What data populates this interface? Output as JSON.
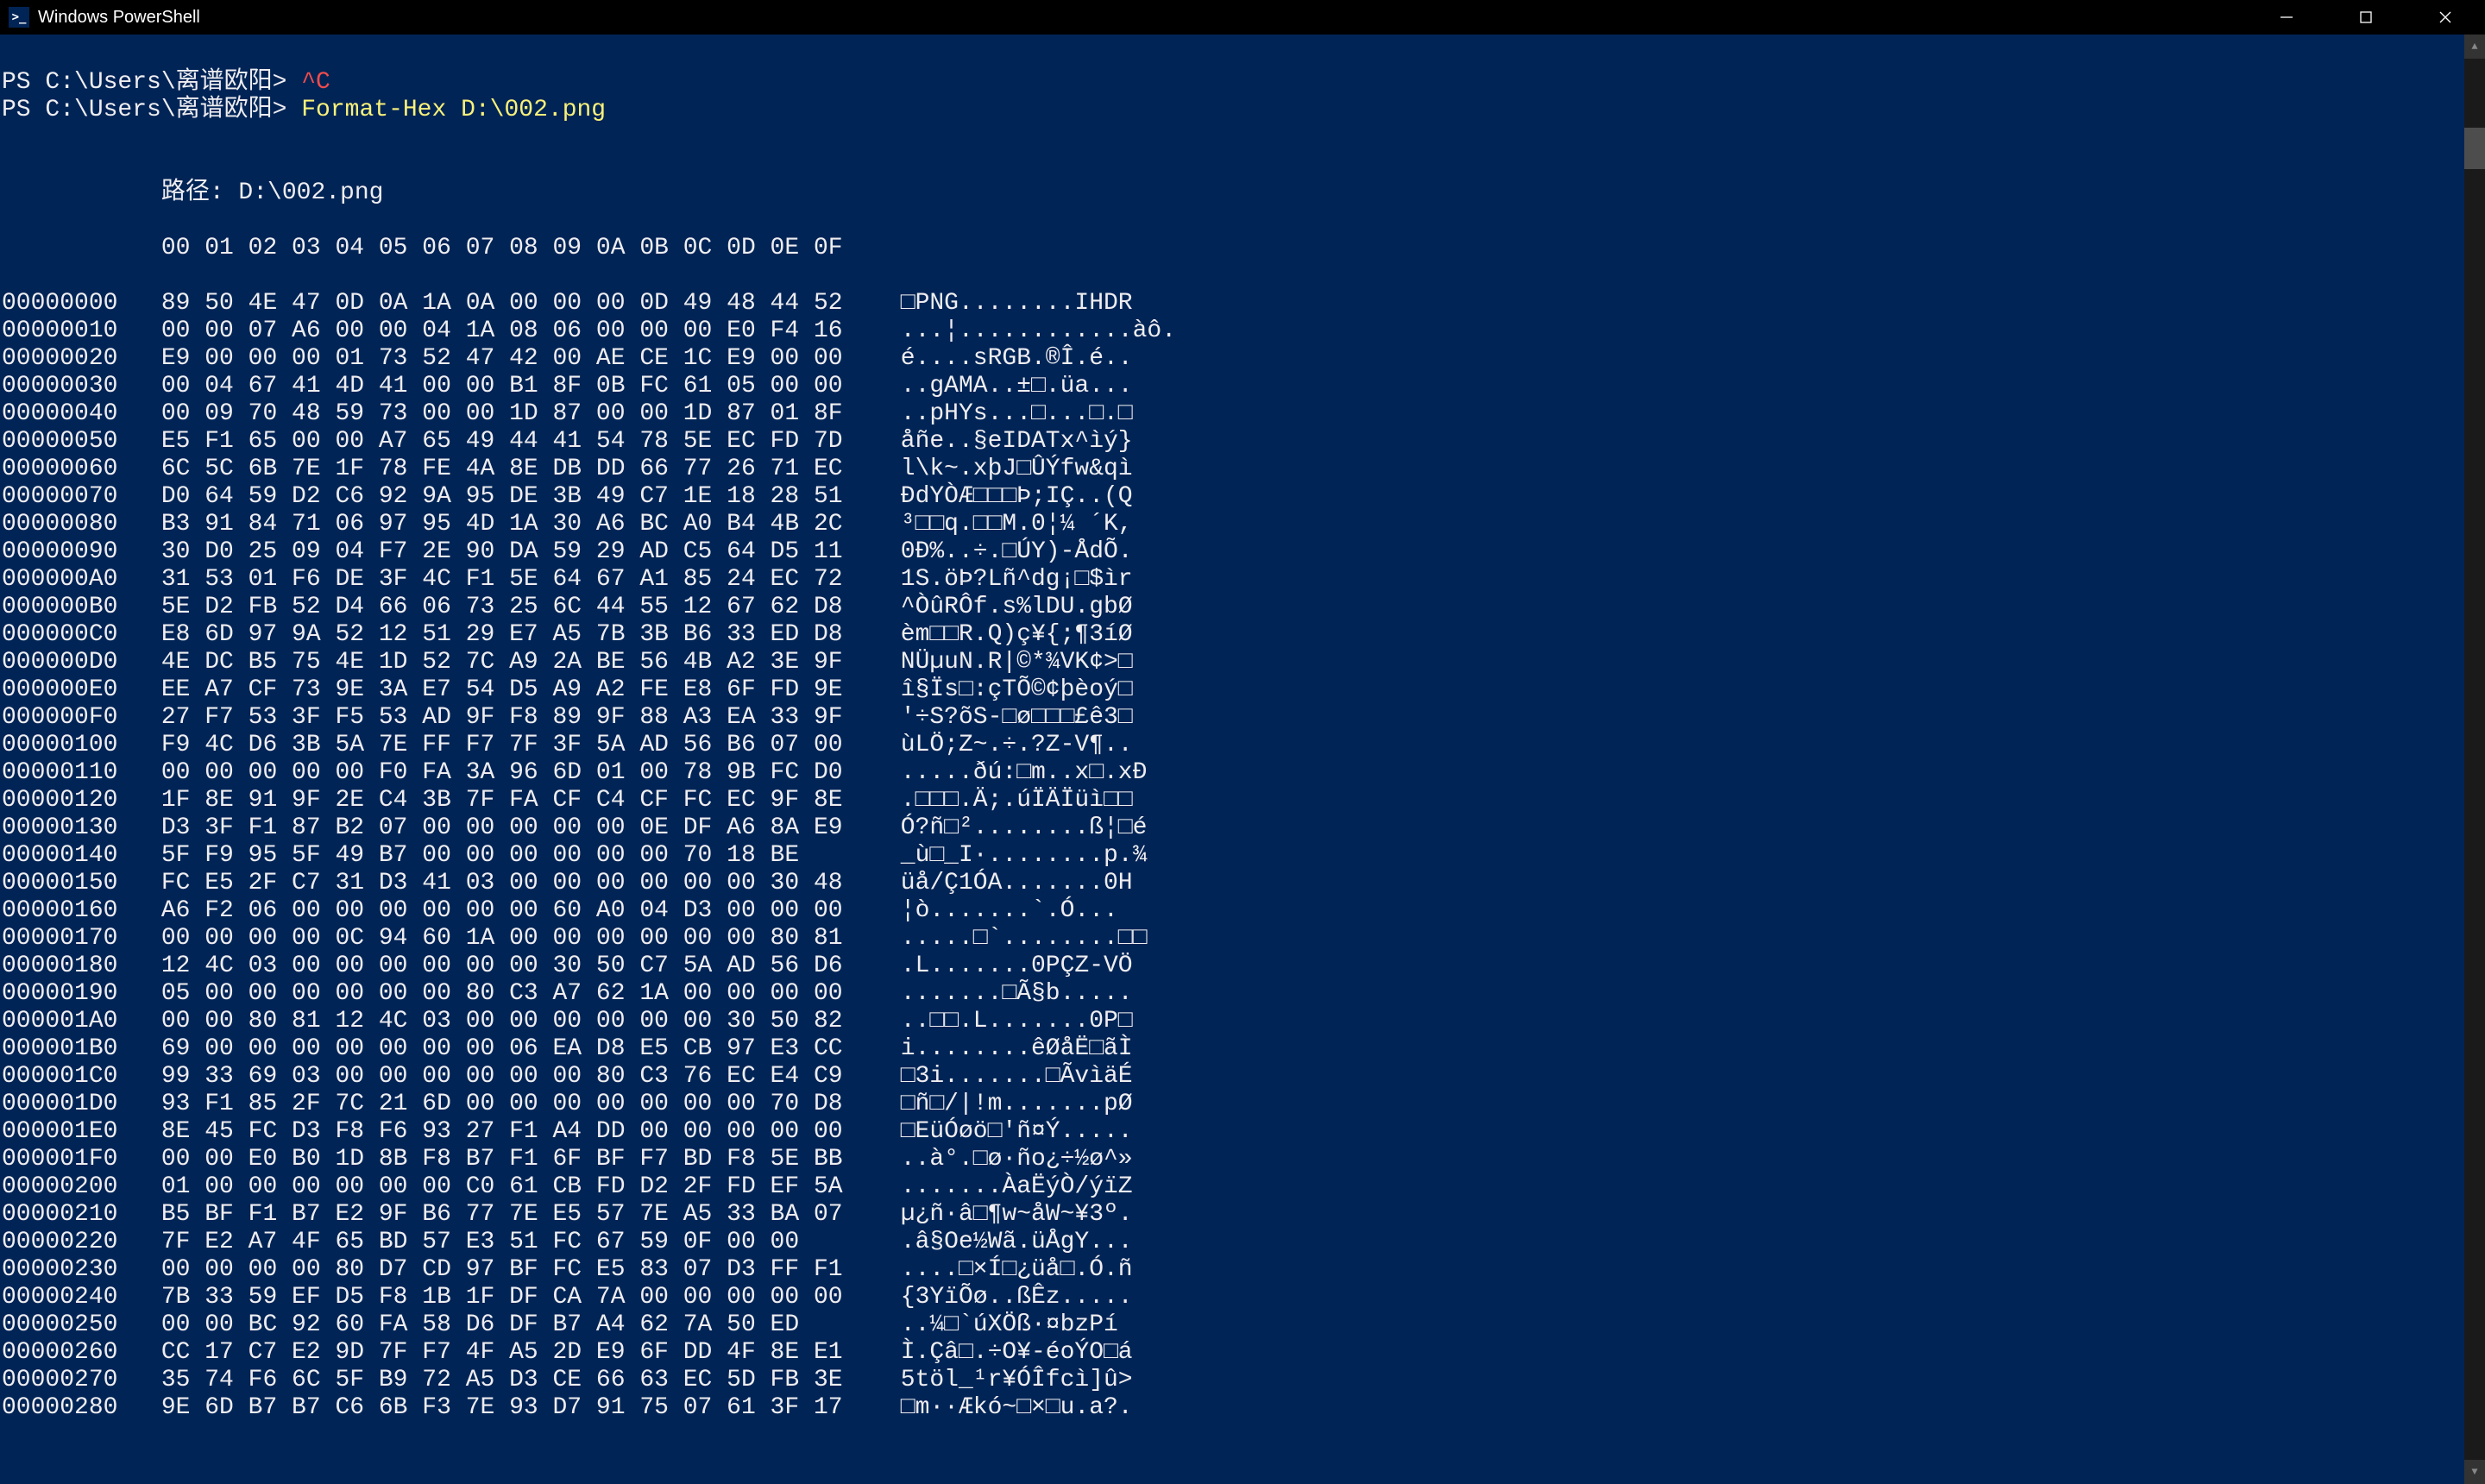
{
  "window": {
    "title": "Windows PowerShell"
  },
  "winbuttons": {
    "min": "minimize",
    "max": "maximize",
    "close": "close"
  },
  "prompt1_prefix": "PS C:\\Users\\离谱欧阳> ",
  "prompt1_cmd": "^C",
  "prompt2_prefix": "PS C:\\Users\\离谱欧阳> ",
  "prompt2_cmd": "Format-Hex D:\\002.png",
  "path_label": "           路径: D:\\002.png",
  "header": "           00 01 02 03 04 05 06 07 08 09 0A 0B 0C 0D 0E 0F",
  "rows": [
    {
      "off": "00000000",
      "hex": "89 50 4E 47 0D 0A 1A 0A 00 00 00 0D 49 48 44 52",
      "asc": "□PNG........IHDR"
    },
    {
      "off": "00000010",
      "hex": "00 00 07 A6 00 00 04 1A 08 06 00 00 00 E0 F4 16",
      "asc": "...¦............àô."
    },
    {
      "off": "00000020",
      "hex": "E9 00 00 00 01 73 52 47 42 00 AE CE 1C E9 00 00",
      "asc": "é....sRGB.®Î.é.."
    },
    {
      "off": "00000030",
      "hex": "00 04 67 41 4D 41 00 00 B1 8F 0B FC 61 05 00 00",
      "asc": "..gAMA..±□.üa..."
    },
    {
      "off": "00000040",
      "hex": "00 09 70 48 59 73 00 00 1D 87 00 00 1D 87 01 8F",
      "asc": "..pHYs...□...□.□"
    },
    {
      "off": "00000050",
      "hex": "E5 F1 65 00 00 A7 65 49 44 41 54 78 5E EC FD 7D",
      "asc": "åñe..§eIDATx^ìý}"
    },
    {
      "off": "00000060",
      "hex": "6C 5C 6B 7E 1F 78 FE 4A 8E DB DD 66 77 26 71 EC",
      "asc": "l\\k~.xþJ□ÛÝfw&qì"
    },
    {
      "off": "00000070",
      "hex": "D0 64 59 D2 C6 92 9A 95 DE 3B 49 C7 1E 18 28 51",
      "asc": "ÐdYÒÆ□□□Þ;IÇ..(Q"
    },
    {
      "off": "00000080",
      "hex": "B3 91 84 71 06 97 95 4D 1A 30 A6 BC A0 B4 4B 2C",
      "asc": "³□□q.□□M.0¦¼ ´K,"
    },
    {
      "off": "00000090",
      "hex": "30 D0 25 09 04 F7 2E 90 DA 59 29 AD C5 64 D5 11",
      "asc": "0Ð%..÷.□ÚY)-ÅdÕ."
    },
    {
      "off": "000000A0",
      "hex": "31 53 01 F6 DE 3F 4C F1 5E 64 67 A1 85 24 EC 72",
      "asc": "1S.öÞ?Lñ^dg¡□$ìr"
    },
    {
      "off": "000000B0",
      "hex": "5E D2 FB 52 D4 66 06 73 25 6C 44 55 12 67 62 D8",
      "asc": "^ÒûRÔf.s%lDU.gbØ"
    },
    {
      "off": "000000C0",
      "hex": "E8 6D 97 9A 52 12 51 29 E7 A5 7B 3B B6 33 ED D8",
      "asc": "èm□□R.Q)ç¥{;¶3íØ"
    },
    {
      "off": "000000D0",
      "hex": "4E DC B5 75 4E 1D 52 7C A9 2A BE 56 4B A2 3E 9F",
      "asc": "NÜµuN.R|©*¾VK¢>□"
    },
    {
      "off": "000000E0",
      "hex": "EE A7 CF 73 9E 3A E7 54 D5 A9 A2 FE E8 6F FD 9E",
      "asc": "î§Ïs□:çTÕ©¢þèoý□"
    },
    {
      "off": "000000F0",
      "hex": "27 F7 53 3F F5 53 AD 9F F8 89 9F 88 A3 EA 33 9F",
      "asc": "'÷S?õS-□ø□□□£ê3□"
    },
    {
      "off": "00000100",
      "hex": "F9 4C D6 3B 5A 7E FF F7 7F 3F 5A AD 56 B6 07 00",
      "asc": "ùLÖ;Z~.÷.?Z-V¶.."
    },
    {
      "off": "00000110",
      "hex": "00 00 00 00 00 F0 FA 3A 96 6D 01 00 78 9B FC D0",
      "asc": ".....ðú:□m..x□.xÐ"
    },
    {
      "off": "00000120",
      "hex": "1F 8E 91 9F 2E C4 3B 7F FA CF C4 CF FC EC 9F 8E",
      "asc": ".□□□.Ä;.úÏÄÏüì□□"
    },
    {
      "off": "00000130",
      "hex": "D3 3F F1 87 B2 07 00 00 00 00 00 0E DF A6 8A E9",
      "asc": "Ó?ñ□²........ß¦□é"
    },
    {
      "off": "00000140",
      "hex": "5F F9 95 5F 49 B7 00 00 00 00 00 00 70 18 BE",
      "asc": "_ù□_I·........p.¾"
    },
    {
      "off": "00000150",
      "hex": "FC E5 2F C7 31 D3 41 03 00 00 00 00 00 00 30 48",
      "asc": "üå/Ç1ÓA.......0H"
    },
    {
      "off": "00000160",
      "hex": "A6 F2 06 00 00 00 00 00 00 60 A0 04 D3 00 00 00",
      "asc": "¦ò.......`.Ó..."
    },
    {
      "off": "00000170",
      "hex": "00 00 00 00 0C 94 60 1A 00 00 00 00 00 00 80 81",
      "asc": ".....□`........□□"
    },
    {
      "off": "00000180",
      "hex": "12 4C 03 00 00 00 00 00 00 30 50 C7 5A AD 56 D6",
      "asc": ".L.......0PÇZ-VÖ"
    },
    {
      "off": "00000190",
      "hex": "05 00 00 00 00 00 00 80 C3 A7 62 1A 00 00 00 00",
      "asc": ".......□Ã§b....."
    },
    {
      "off": "000001A0",
      "hex": "00 00 80 81 12 4C 03 00 00 00 00 00 00 30 50 82",
      "asc": "..□□.L.......0P□"
    },
    {
      "off": "000001B0",
      "hex": "69 00 00 00 00 00 00 00 06 EA D8 E5 CB 97 E3 CC",
      "asc": "i........êØåË□ãÌ"
    },
    {
      "off": "000001C0",
      "hex": "99 33 69 03 00 00 00 00 00 00 80 C3 76 EC E4 C9",
      "asc": "□3i.......□ÃvìäÉ"
    },
    {
      "off": "000001D0",
      "hex": "93 F1 85 2F 7C 21 6D 00 00 00 00 00 00 00 70 D8",
      "asc": "□ñ□/|!m.......pØ"
    },
    {
      "off": "000001E0",
      "hex": "8E 45 FC D3 F8 F6 93 27 F1 A4 DD 00 00 00 00 00",
      "asc": "□EüÓøö□'ñ¤Ý....."
    },
    {
      "off": "000001F0",
      "hex": "00 00 E0 B0 1D 8B F8 B7 F1 6F BF F7 BD F8 5E BB",
      "asc": "..à°.□ø·ño¿÷½ø^»"
    },
    {
      "off": "00000200",
      "hex": "01 00 00 00 00 00 00 C0 61 CB FD D2 2F FD EF 5A",
      "asc": ".......ÀaËýÒ/ýïZ"
    },
    {
      "off": "00000210",
      "hex": "B5 BF F1 B7 E2 9F B6 77 7E E5 57 7E A5 33 BA 07",
      "asc": "µ¿ñ·â□¶w~åW~¥3º."
    },
    {
      "off": "00000220",
      "hex": "7F E2 A7 4F 65 BD 57 E3 51 FC 67 59 0F 00 00",
      "asc": ".â§Oe½Wã.üÅgY..."
    },
    {
      "off": "00000230",
      "hex": "00 00 00 00 80 D7 CD 97 BF FC E5 83 07 D3 FF F1",
      "asc": "....□×Í□¿üå□.Ó.ñ"
    },
    {
      "off": "00000240",
      "hex": "7B 33 59 EF D5 F8 1B 1F DF CA 7A 00 00 00 00 00",
      "asc": "{3YïÕø..ßÊz....."
    },
    {
      "off": "00000250",
      "hex": "00 00 BC 92 60 FA 58 D6 DF B7 A4 62 7A 50 ED",
      "asc": "..¼□`úXÖß·¤bzPí"
    },
    {
      "off": "00000260",
      "hex": "CC 17 C7 E2 9D 7F F7 4F A5 2D E9 6F DD 4F 8E E1",
      "asc": "Ì.Çâ□.÷O¥-éoÝO□á"
    },
    {
      "off": "00000270",
      "hex": "35 74 F6 6C 5F B9 72 A5 D3 CE 66 63 EC 5D FB 3E",
      "asc": "5töl_¹r¥ÓÎfcì]û>"
    },
    {
      "off": "00000280",
      "hex": "9E 6D B7 B7 C6 6B F3 7E 93 D7 91 75 07 61 3F 17",
      "asc": "□m··Ækó~□×□u.a?."
    }
  ]
}
